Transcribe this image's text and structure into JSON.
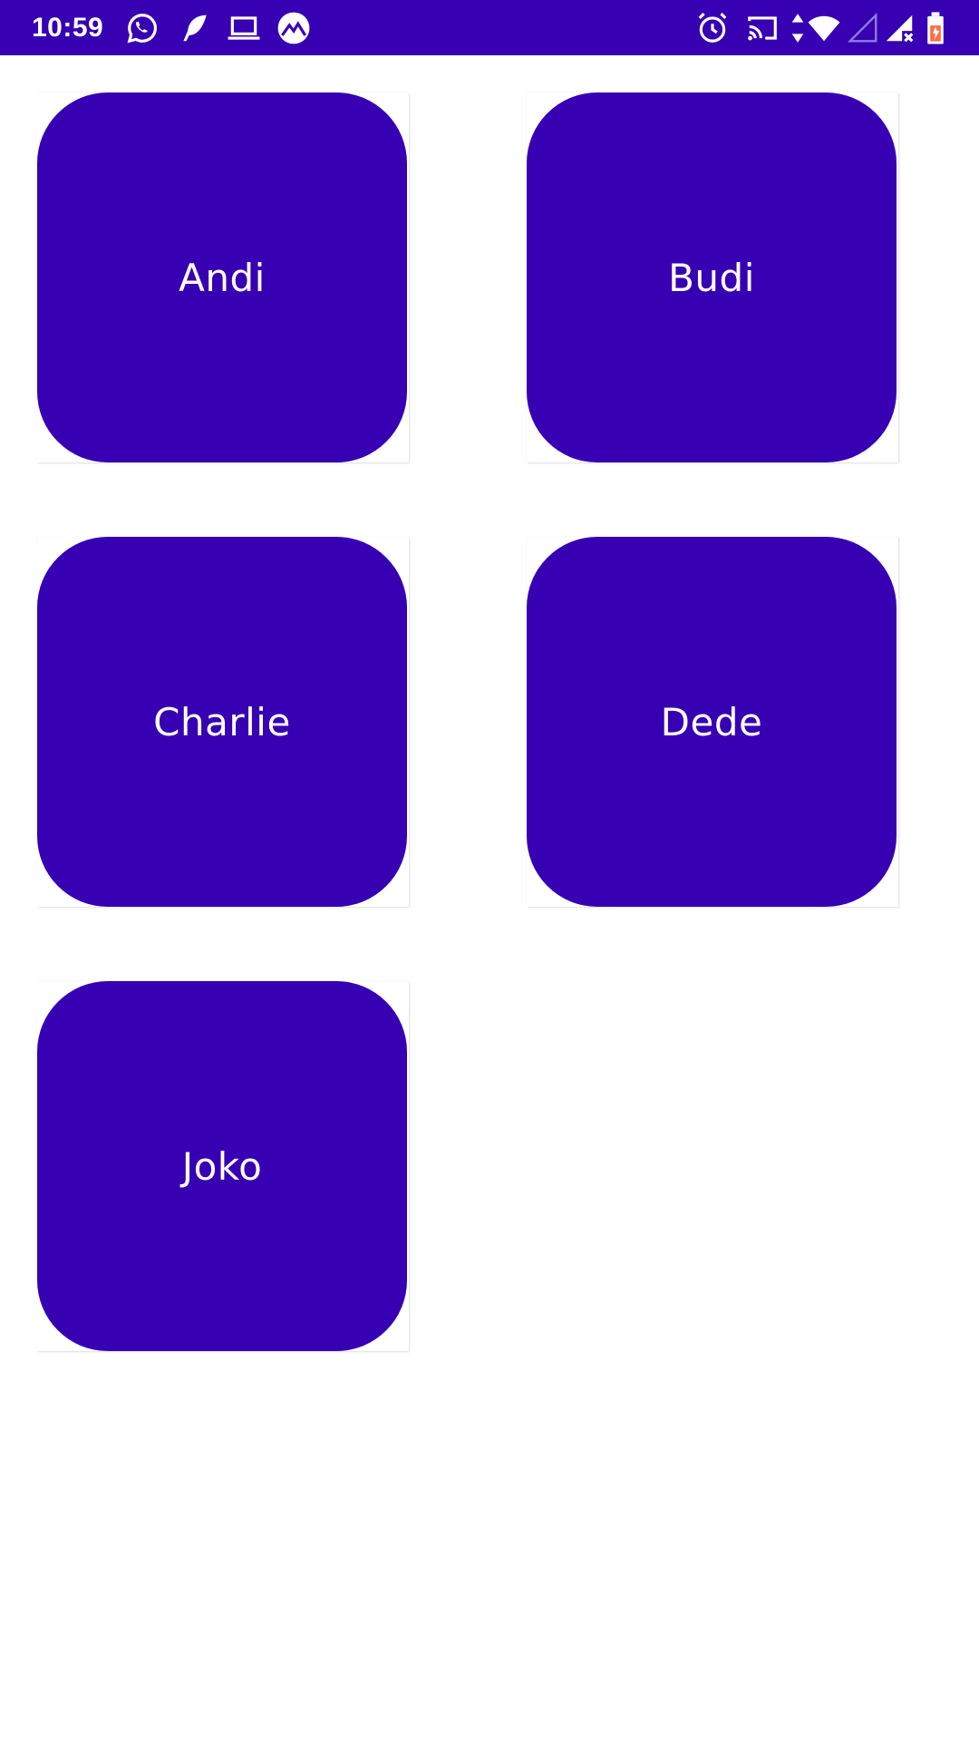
{
  "status_bar": {
    "time": "10:59",
    "background_color": "#3700b3",
    "left_icons": [
      "whatsapp-icon",
      "feather-app-icon",
      "laptop-icon",
      "app-badge-icon"
    ],
    "right_icons": [
      "alarm-icon",
      "cast-icon",
      "data-arrows-icon",
      "wifi-icon",
      "signal-empty-icon",
      "signal-no-data-icon",
      "battery-charging-icon"
    ]
  },
  "grid": {
    "card_color": "#3700b3",
    "text_color": "#ffffff",
    "items": [
      {
        "label": "Andi"
      },
      {
        "label": "Budi"
      },
      {
        "label": "Charlie"
      },
      {
        "label": "Dede"
      },
      {
        "label": "Joko"
      }
    ]
  }
}
